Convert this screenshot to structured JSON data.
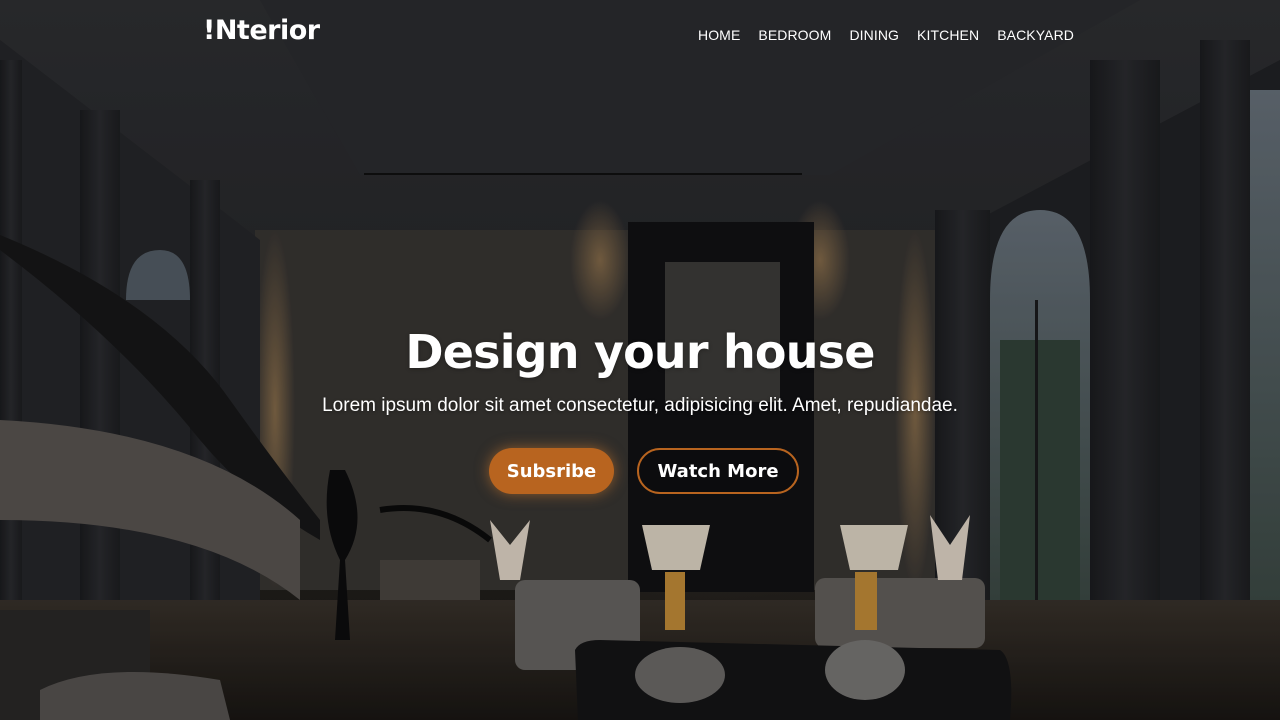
{
  "brand": {
    "logo": "!Nterior"
  },
  "nav": {
    "items": [
      {
        "label": "HOME"
      },
      {
        "label": "BEDROOM"
      },
      {
        "label": "DINING"
      },
      {
        "label": "KITCHEN"
      },
      {
        "label": "BACKYARD"
      }
    ]
  },
  "hero": {
    "title": "Design your house",
    "subtitle": "Lorem ipsum dolor sit amet consectetur, adipisicing elit. Amet, repudiandae.",
    "primary_button": "Subsribe",
    "secondary_button": "Watch More",
    "background_image": "luxury-living-room-interior"
  },
  "colors": {
    "accent": "#b8641f",
    "text": "#ffffff",
    "background": "#26272a"
  }
}
